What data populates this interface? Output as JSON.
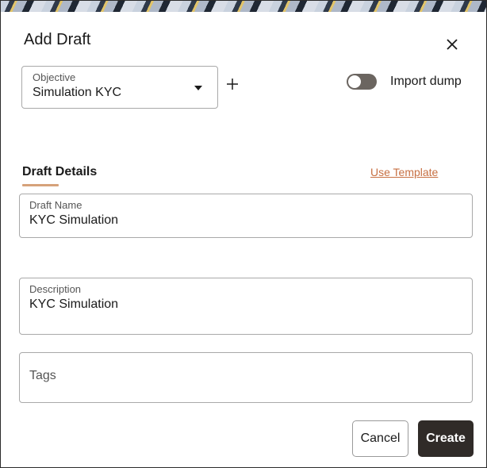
{
  "dialog": {
    "title": "Add Draft",
    "close_icon": "close-icon"
  },
  "objective": {
    "label": "Objective",
    "value": "Simulation KYC",
    "dropdown_icon": "caret-down-icon",
    "add_icon": "plus-icon"
  },
  "import_dump": {
    "label": "Import dump",
    "enabled": false
  },
  "draft_details": {
    "section_title": "Draft Details",
    "use_template_link": "Use Template",
    "draft_name": {
      "label": "Draft Name",
      "value": "KYC Simulation"
    },
    "description": {
      "label": "Description",
      "value": "KYC Simulation"
    },
    "tags": {
      "placeholder": "Tags",
      "value": ""
    }
  },
  "actions": {
    "cancel_label": "Cancel",
    "create_label": "Create"
  },
  "colors": {
    "accent": "#c77043",
    "underline": "#d6a27a",
    "primary_button": "#302b28",
    "toggle_off": "#6b6560"
  }
}
